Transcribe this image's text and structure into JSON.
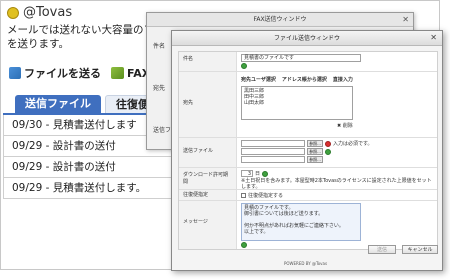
{
  "app": {
    "title": "@Tovas",
    "description": "メールでは送れない大容量のファイルを送ります。",
    "action_send": "ファイルを送る",
    "action_fax": "FAXを送",
    "tab_active": "送信ファイル",
    "tab_inactive": "往復便",
    "list": [
      "09/30 - 見積書送付します",
      "09/29 - 設計書の送付",
      "09/29 - 設計書の送付",
      "09/29 - 見積書送付します。"
    ]
  },
  "fax_dialog": {
    "title": "FAX送信ウィンドウ",
    "label_subject": "件名",
    "label_to": "宛先",
    "label_file": "送信ファイル"
  },
  "dialog": {
    "title": "ファイル送信ウィンドウ",
    "subject_label": "件名",
    "subject_value": "見積書のファイルです",
    "to_label": "宛先",
    "to_btn_user": "宛先ユーザ選択",
    "to_btn_address": "アドレス帳から選択",
    "to_btn_direct": "直接入力",
    "recipients": [
      "黒田三郎",
      "田中三郎",
      "山田太郎"
    ],
    "delete_label": "削除",
    "file_label": "送信ファイル",
    "browse": "参照...",
    "file_required": "入力は必須です。",
    "dl_label": "ダウンロード許可期間",
    "dl_value": "3",
    "dl_unit": "日",
    "dl_note": "※土日祝日を含みます。本屋型時2本Tovasのライセンスに設定された上限値をセットします。",
    "roundtrip_label": "往復便指定",
    "roundtrip_option": "往復便指定する",
    "message_label": "メッセージ",
    "message_lines": [
      "見積のファイルです。",
      "御引書については後ほど送ります。",
      "",
      "何か不明点があればお気軽にご連絡下さい。",
      "以上です。"
    ],
    "send_button": "送信",
    "cancel_button": "キャンセル",
    "powered": "POWERED BY @Tovas"
  }
}
